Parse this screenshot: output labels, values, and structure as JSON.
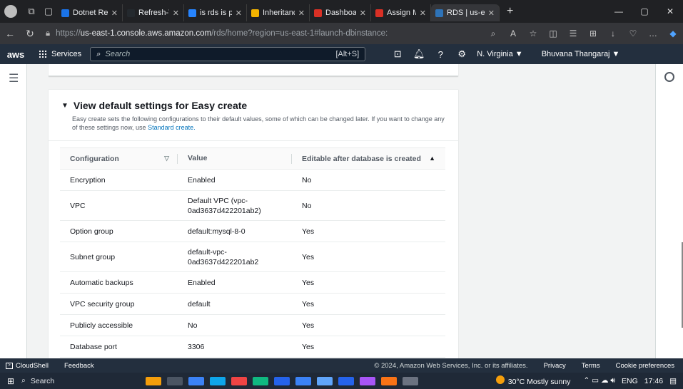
{
  "browser": {
    "tabs": [
      {
        "label": "Dotnet Repo",
        "color": "#1a73e8",
        "active": false
      },
      {
        "label": "Refresh-Task",
        "color": "#24292e",
        "active": false
      },
      {
        "label": "is rds is paya",
        "color": "#2684ff",
        "active": false
      },
      {
        "label": "Inheritance -",
        "color": "#f4b400",
        "active": false
      },
      {
        "label": "Dashboard |",
        "color": "#d93025",
        "active": false
      },
      {
        "label": "Assign MFA -",
        "color": "#d93025",
        "active": false
      },
      {
        "label": "RDS | us-east",
        "color": "#2e73b8",
        "active": true
      }
    ],
    "url_prefix": "https://",
    "url_host": "us-east-1.console.aws.amazon.com",
    "url_path": "/rds/home?region=us-east-1#launch-dbinstance:"
  },
  "aws_nav": {
    "logo": "aws",
    "services": "Services",
    "search_placeholder": "Search",
    "search_shortcut": "[Alt+S]",
    "region": "N. Virginia ▼",
    "user": "Bhuvana Thangaraj ▼"
  },
  "section": {
    "title": "View default settings for Easy create",
    "description": "Easy create sets the following configurations to their default values, some of which can be changed later. If you want to change any of these settings now, use",
    "link": "Standard create."
  },
  "table": {
    "headers": [
      "Configuration",
      "Value",
      "Editable after database is created"
    ],
    "rows": [
      {
        "config": "Encryption",
        "value": "Enabled",
        "editable": "No"
      },
      {
        "config": "VPC",
        "value": "Default VPC (vpc-0ad3637d422201ab2)",
        "editable": "No"
      },
      {
        "config": "Option group",
        "value": "default:mysql-8-0",
        "editable": "Yes"
      },
      {
        "config": "Subnet group",
        "value": "default-vpc-0ad3637d422201ab2",
        "editable": "Yes"
      },
      {
        "config": "Automatic backups",
        "value": "Enabled",
        "editable": "Yes"
      },
      {
        "config": "VPC security group",
        "value": "default",
        "editable": "Yes"
      },
      {
        "config": "Publicly accessible",
        "value": "No",
        "editable": "Yes"
      },
      {
        "config": "Database port",
        "value": "3306",
        "editable": "Yes"
      }
    ]
  },
  "footer": {
    "cloudshell": "CloudShell",
    "feedback": "Feedback",
    "copyright": "© 2024, Amazon Web Services, Inc. or its affiliates.",
    "privacy": "Privacy",
    "terms": "Terms",
    "cookies": "Cookie preferences"
  },
  "taskbar": {
    "search": "Search",
    "weather": "30°C  Mostly sunny",
    "lang": "ENG",
    "time": "17:46"
  }
}
